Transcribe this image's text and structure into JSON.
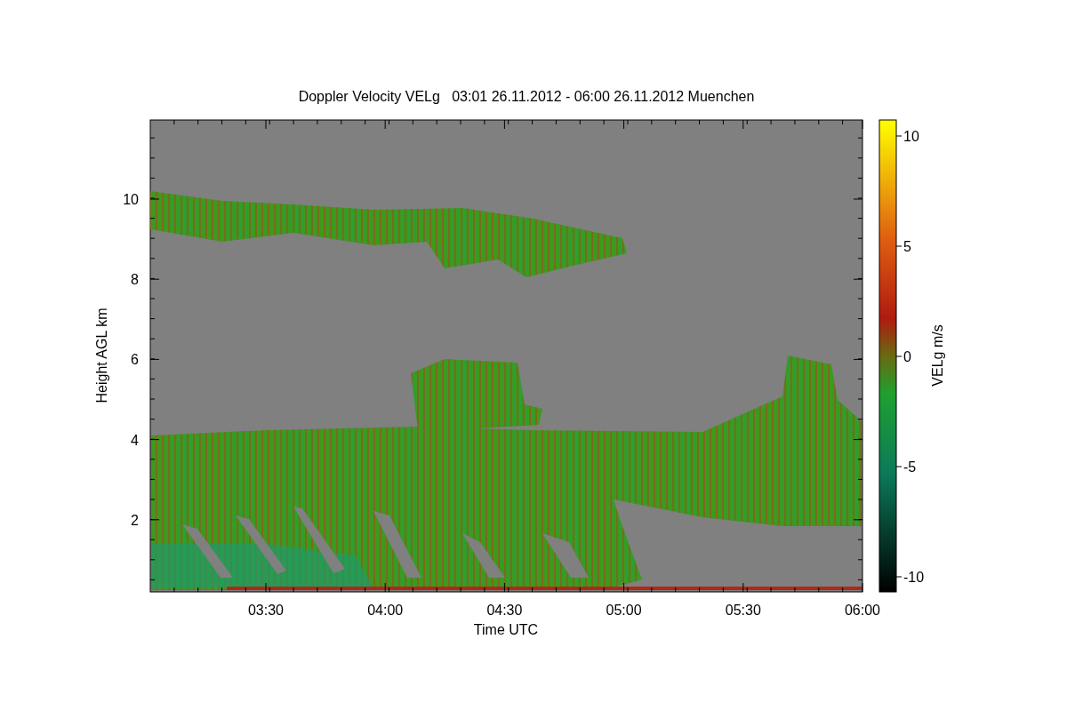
{
  "title": "Doppler Velocity VELg   03:01 26.11.2012 - 06:00 26.11.2012 Muenchen",
  "plot": {
    "xlabel": "Time UTC",
    "ylabel": "Height AGL km",
    "xticks": [
      "03:30",
      "04:00",
      "04:30",
      "05:00",
      "05:30",
      "06:00"
    ],
    "yticks": [
      "10",
      "8",
      "6",
      "4",
      "2"
    ]
  },
  "colorbar": {
    "label": "VELg m/s",
    "ticks": [
      "10",
      "5",
      "0",
      "-5",
      "-10"
    ]
  }
}
